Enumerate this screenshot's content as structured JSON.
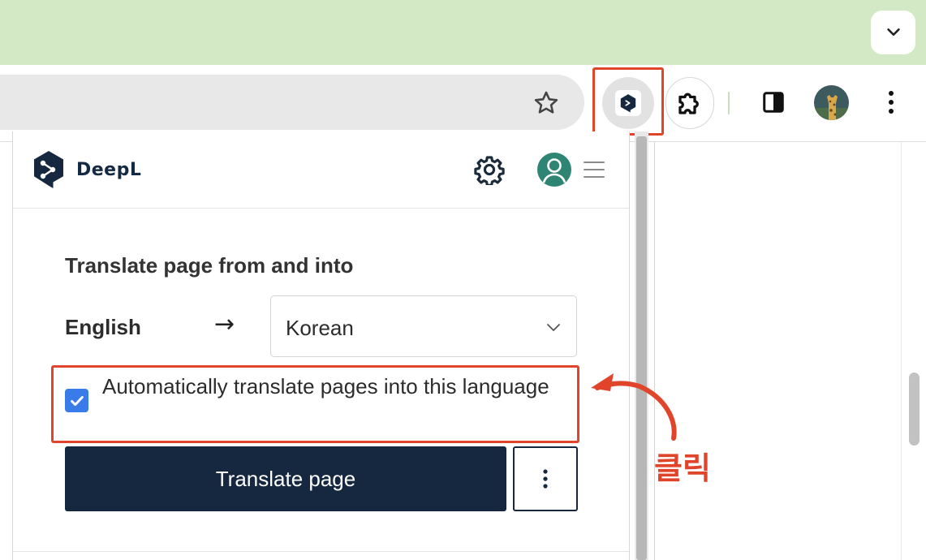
{
  "toolbar": {
    "extensions": [
      {
        "icon": "deepl-extension-icon",
        "highlighted": true
      },
      {
        "icon": "puzzle-icon"
      }
    ]
  },
  "popup": {
    "brand_name": "DeepL",
    "section_title": "Translate page from and into",
    "source_language": "English",
    "arrow": "→",
    "target_language": "Korean",
    "auto_translate_label": "Automatically translate pages into this language",
    "auto_translate_checked": true,
    "translate_button_label": "Translate page"
  },
  "annotation": {
    "text": "클릭",
    "color": "#e0452c"
  },
  "colors": {
    "tabstrip": "#d3e9c5",
    "deepl_navy": "#15283f",
    "checkbox_blue": "#3a7bea",
    "account_teal": "#2f8574"
  }
}
